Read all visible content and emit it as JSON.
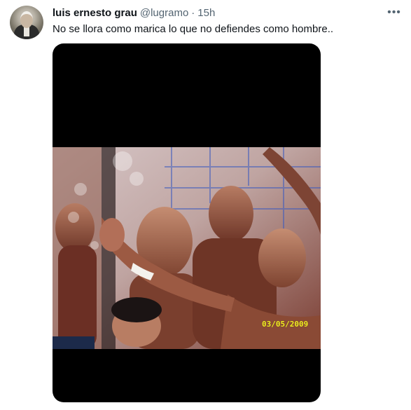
{
  "tweet": {
    "author": {
      "display_name": "luis ernesto grau",
      "handle": "@lugramo",
      "separator": "·",
      "time": "15h"
    },
    "more_icon": "more-horizontal-icon",
    "text": "No se llora como marica lo que no defiendes como hombre..",
    "media": {
      "date_stamp": "03/05/2009",
      "date_stamp_color": "#f2ef21"
    }
  }
}
